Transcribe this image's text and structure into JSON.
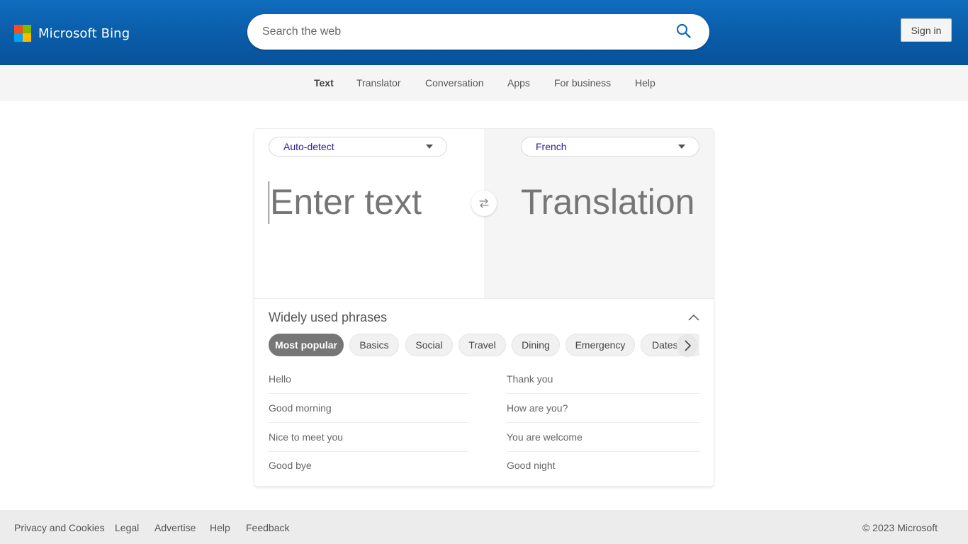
{
  "header": {
    "brand": "Microsoft Bing",
    "logo_colors": [
      "#f25022",
      "#7fba00",
      "#00a4ef",
      "#ffb900"
    ],
    "search_placeholder": "Search the web",
    "search_value": "",
    "search_icon": "search-icon",
    "sign_in_label": "Sign in"
  },
  "nav": {
    "items": [
      {
        "label": "Text",
        "active": true
      },
      {
        "label": "Translator",
        "active": false
      },
      {
        "label": "Conversation",
        "active": false
      },
      {
        "label": "Apps",
        "active": false
      },
      {
        "label": "For business",
        "active": false
      },
      {
        "label": "Help",
        "active": false
      }
    ]
  },
  "translator": {
    "source_language": "Auto-detect",
    "target_language": "French",
    "source_placeholder": "Enter text",
    "source_value": "",
    "target_placeholder": "Translation",
    "swap_icon": "swap-arrows-icon"
  },
  "phrases": {
    "title": "Widely used phrases",
    "collapse_icon": "chevron-up-icon",
    "next_icon": "chevron-right-icon",
    "categories": [
      {
        "label": "Most popular",
        "active": true
      },
      {
        "label": "Basics",
        "active": false
      },
      {
        "label": "Social",
        "active": false
      },
      {
        "label": "Travel",
        "active": false
      },
      {
        "label": "Dining",
        "active": false
      },
      {
        "label": "Emergency",
        "active": false
      },
      {
        "label": "Dates",
        "active": false
      }
    ],
    "left_column": [
      "Hello",
      "Good morning",
      "Nice to meet you",
      "Good bye"
    ],
    "right_column": [
      "Thank you",
      "How are you?",
      "You are welcome",
      "Good night"
    ]
  },
  "footer": {
    "links": [
      "Privacy and Cookies",
      "Legal",
      "Advertise",
      "Help",
      "Feedback"
    ],
    "copyright": "© 2023 Microsoft"
  },
  "colors": {
    "header_blue": "#0f6cbd",
    "language_text": "#2b1b9b",
    "active_chip": "#767676",
    "search_icon": "#0f6cbd"
  }
}
